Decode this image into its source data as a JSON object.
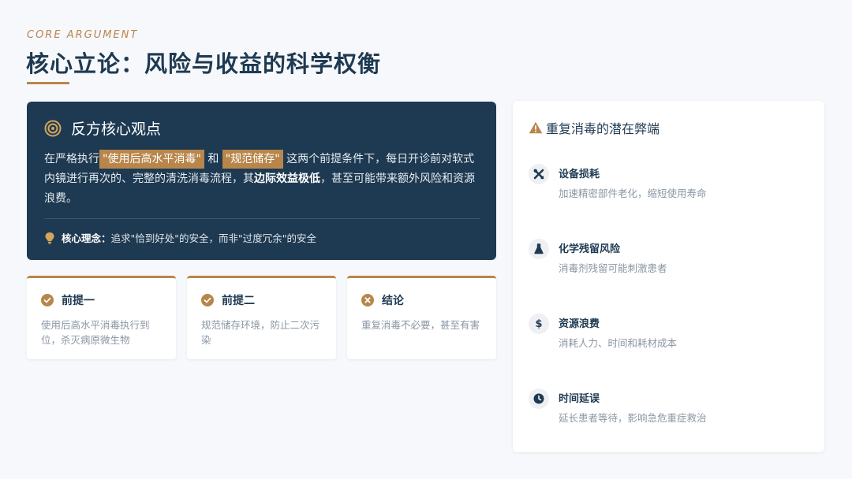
{
  "header": {
    "eyebrow": "CORE ARGUMENT",
    "title": "核心立论：风险与收益的科学权衡"
  },
  "dark_card": {
    "title": "反方核心观点",
    "body_1": "在严格执行",
    "highlight_1": "\"使用后高水平消毒\"",
    "body_2": " 和 ",
    "highlight_2": "\"规范储存\"",
    "body_3": " 这两个前提条件下，每日开诊前对软式内镜进行再次的、完整的清洗消毒流程，其",
    "strong": "边际效益极低",
    "body_4": "，甚至可能带来额外风险和资源浪费。",
    "foot_label": "核心理念：",
    "foot_text": "追求\"恰到好处\"的安全，而非\"过度冗余\"的安全"
  },
  "cards": [
    {
      "title": "前提一",
      "body": "使用后高水平消毒执行到位，杀灭病原微生物",
      "icon": "check-circle-icon"
    },
    {
      "title": "前提二",
      "body": "规范储存环境，防止二次污染",
      "icon": "check-circle-icon"
    },
    {
      "title": "结论",
      "body": "重复消毒不必要，甚至有害",
      "icon": "x-circle-icon"
    }
  ],
  "right_panel": {
    "title": "重复消毒的潜在弊端",
    "items": [
      {
        "title": "设备损耗",
        "desc": "加速精密部件老化，缩短使用寿命",
        "icon": "tools-icon"
      },
      {
        "title": "化学残留风险",
        "desc": "消毒剂残留可能刺激患者",
        "icon": "flask-icon"
      },
      {
        "title": "资源浪费",
        "desc": "消耗人力、时间和耗材成本",
        "icon": "dollar-icon"
      },
      {
        "title": "时间延误",
        "desc": "延长患者等待，影响急危重症救治",
        "icon": "clock-icon"
      }
    ]
  },
  "colors": {
    "navy": "#1e3a52",
    "gold": "#b8864b",
    "muted": "#8a96a3",
    "background": "#f7f8fb"
  }
}
